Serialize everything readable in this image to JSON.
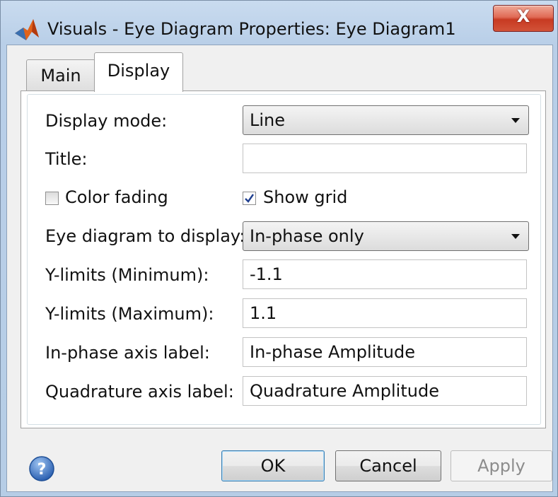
{
  "window": {
    "title": "Visuals - Eye Diagram Properties: Eye Diagram1",
    "close_label": "X"
  },
  "tabs": [
    {
      "label": "Main",
      "selected": false
    },
    {
      "label": "Display",
      "selected": true
    }
  ],
  "form": {
    "display_mode": {
      "label": "Display mode:",
      "value": "Line"
    },
    "title": {
      "label": "Title:",
      "value": ""
    },
    "color_fading": {
      "label": "Color fading",
      "checked": false
    },
    "show_grid": {
      "label": "Show grid",
      "checked": true
    },
    "eye_diagram": {
      "label": "Eye diagram to display:",
      "value": "In-phase only"
    },
    "ylim_min": {
      "label": "Y-limits (Minimum):",
      "value": "-1.1"
    },
    "ylim_max": {
      "label": "Y-limits (Maximum):",
      "value": "1.1"
    },
    "inphase_label": {
      "label": "In-phase axis label:",
      "value": "In-phase Amplitude"
    },
    "quad_label": {
      "label": "Quadrature axis label:",
      "value": "Quadrature Amplitude"
    }
  },
  "buttons": {
    "ok": "OK",
    "cancel": "Cancel",
    "apply": "Apply"
  },
  "icons": {
    "app": "matlab-logo-icon",
    "help": "help-question-icon"
  }
}
